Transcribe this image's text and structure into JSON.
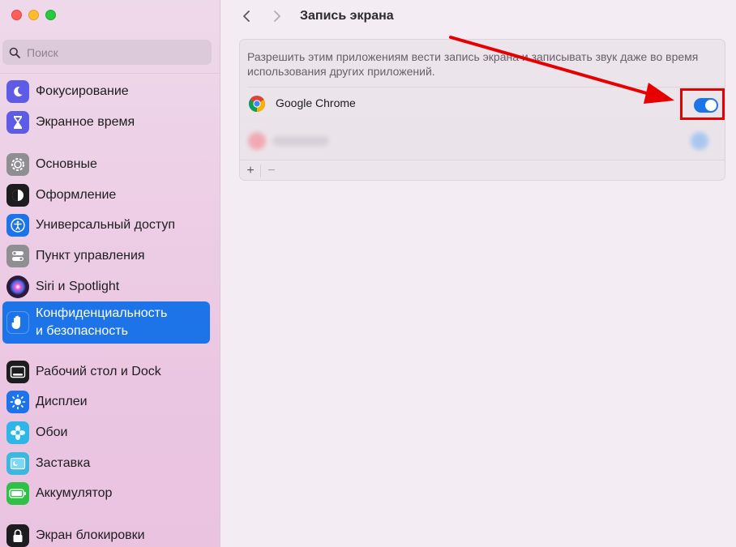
{
  "sidebar": {
    "search_placeholder": "Поиск",
    "items": [
      {
        "label": "Фокусирование",
        "icon": "moon-icon",
        "color": "#5e5ce6"
      },
      {
        "label": "Экранное время",
        "icon": "hourglass-icon",
        "color": "#5e5ce6"
      },
      {
        "label": "Основные",
        "icon": "gear-icon",
        "color": "#8e8e93"
      },
      {
        "label": "Оформление",
        "icon": "appearance-icon",
        "color": "#1d1d1f"
      },
      {
        "label": "Универсальный доступ",
        "icon": "accessibility-icon",
        "color": "#1d74e8"
      },
      {
        "label": "Пункт управления",
        "icon": "control-center-icon",
        "color": "#8e8e93"
      },
      {
        "label": "Siri и Spotlight",
        "icon": "siri-icon",
        "color": "#2b1a3d"
      },
      {
        "label_line1": "Конфиденциальность",
        "label_line2": "и безопасность",
        "icon": "hand-icon",
        "color": "#1d74e8",
        "active": true
      },
      {
        "label": "Рабочий стол и Dock",
        "icon": "dock-icon",
        "color": "#1d1d1f"
      },
      {
        "label": "Дисплеи",
        "icon": "sun-icon",
        "color": "#1d74e8"
      },
      {
        "label": "Обои",
        "icon": "flower-icon",
        "color": "#2fb6e8"
      },
      {
        "label": "Заставка",
        "icon": "screensaver-icon",
        "color": "#3ab8e0"
      },
      {
        "label": "Аккумулятор",
        "icon": "battery-icon",
        "color": "#30c048"
      },
      {
        "label": "Экран блокировки",
        "icon": "lock-icon",
        "color": "#1d1d1f"
      }
    ]
  },
  "main": {
    "title": "Запись экрана",
    "description": "Разрешить этим приложениям вести запись экрана и записывать звук даже во время использования других приложений.",
    "apps": [
      {
        "name": "Google Chrome",
        "enabled": true
      }
    ],
    "add_label": "+",
    "remove_label": "−"
  },
  "colors": {
    "accent": "#1d74e8",
    "annotation": "#e60000"
  }
}
